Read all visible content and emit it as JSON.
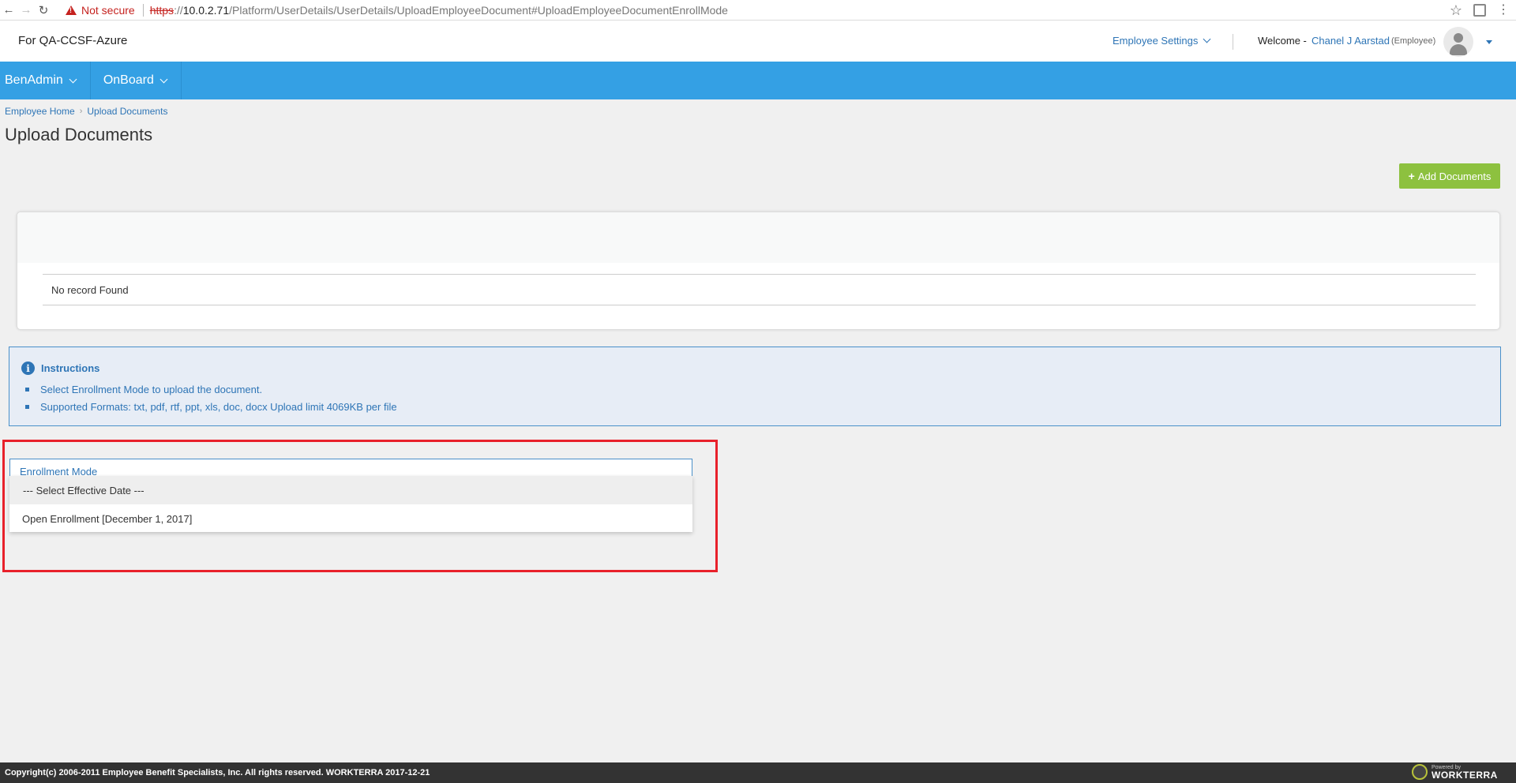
{
  "browser": {
    "security_text": "Not secure",
    "url_scheme": "https",
    "url_sep": "://",
    "url_host": "10.0.2.71",
    "url_path": "/Platform/UserDetails/UserDetails/UploadEmployeeDocument#UploadEmployeeDocumentEnrollMode"
  },
  "header": {
    "org_name": "For QA-CCSF-Azure",
    "employee_settings": "Employee Settings",
    "welcome": "Welcome -",
    "user_name": "Chanel J Aarstad",
    "user_role": "(Employee)"
  },
  "nav": {
    "items": [
      {
        "label": "BenAdmin"
      },
      {
        "label": "OnBoard"
      }
    ]
  },
  "breadcrumb": {
    "items": [
      "Employee Home",
      "Upload Documents"
    ],
    "separator": "›"
  },
  "page": {
    "title": "Upload Documents",
    "add_button": "Add Documents",
    "add_button_icon": "+"
  },
  "records": {
    "empty_text": "No record Found"
  },
  "instructions": {
    "title": "Instructions",
    "items": [
      "Select Enrollment Mode to upload the document.",
      "Supported Formats: txt, pdf, rtf, ppt, xls, doc, docx Upload limit 4069KB per file"
    ]
  },
  "enrollment": {
    "label": "Enrollment Mode",
    "options": [
      "--- Select Effective Date ---",
      "Open Enrollment [December 1, 2017]"
    ],
    "selected_index": 0
  },
  "footer": {
    "copyright": "Copyright(c) 2006-2011 Employee Benefit Specialists, Inc. All rights reserved. WORKTERRA 2017-12-21",
    "powered_by": "Powered by",
    "brand": "WORKTERRA"
  },
  "colors": {
    "nav_blue": "#34a0e4",
    "link_blue": "#2e75b6",
    "add_button_green": "#8dc13f",
    "highlight_red": "#e8212b",
    "footer_dark": "#333333"
  }
}
